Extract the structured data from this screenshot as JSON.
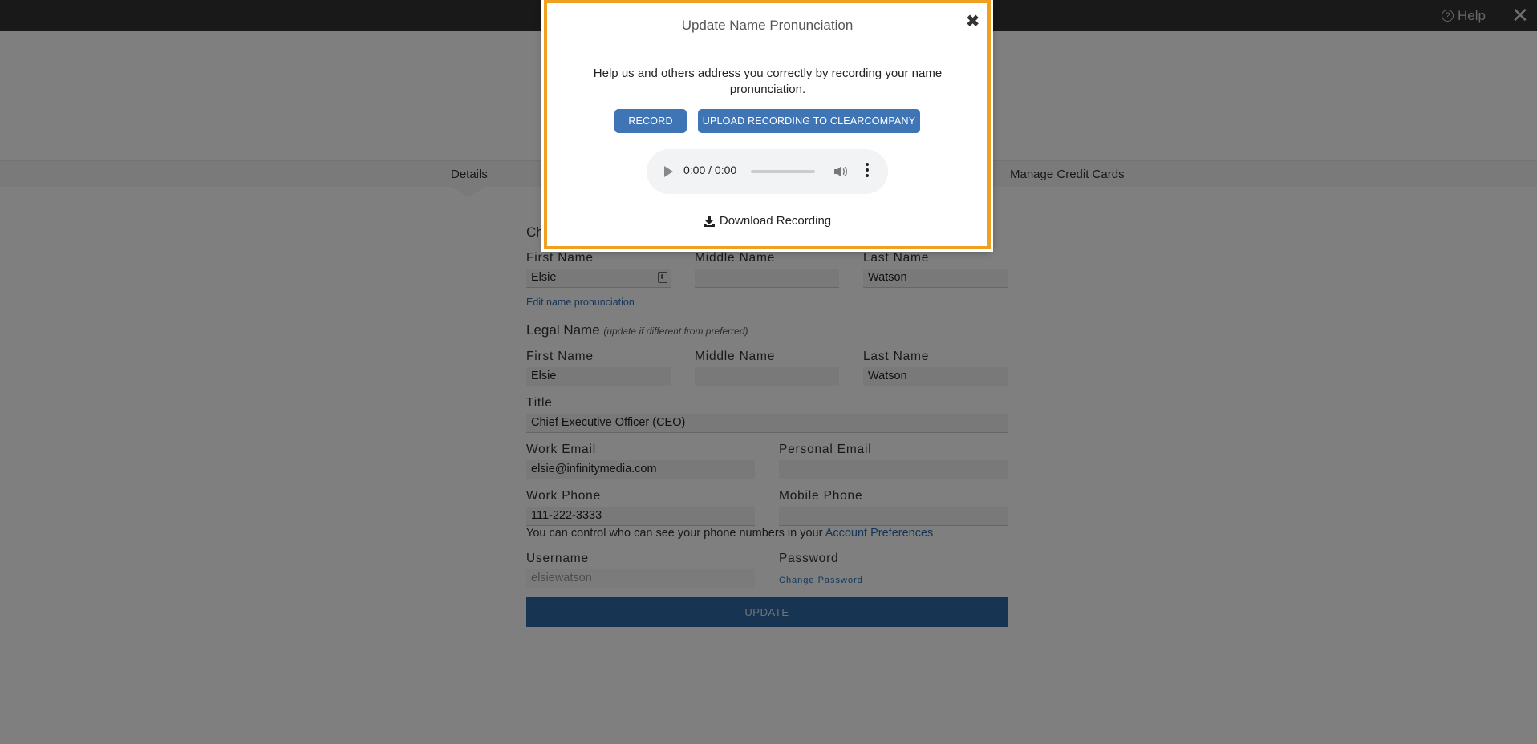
{
  "topbar": {
    "help_label": "Help",
    "close_glyph": "✕"
  },
  "tabs": {
    "details": "Details",
    "manage_cards": "Manage Credit Cards"
  },
  "preferred": {
    "heading_partial": "Ch",
    "first_name_label": "First Name",
    "first_name_value": "Elsie",
    "middle_name_label": "Middle Name",
    "middle_name_value": "",
    "last_name_label": "Last Name",
    "last_name_value": "Watson",
    "edit_pronunciation_link": "Edit name pronunciation"
  },
  "legal": {
    "heading": "Legal Name",
    "heading_note": "(update if different from preferred)",
    "first_name_label": "First Name",
    "first_name_value": "Elsie",
    "middle_name_label": "Middle Name",
    "middle_name_value": "",
    "last_name_label": "Last Name",
    "last_name_value": "Watson"
  },
  "title": {
    "label": "Title",
    "value": "Chief Executive Officer (CEO)"
  },
  "email": {
    "work_label": "Work Email",
    "work_value": "elsie@infinitymedia.com",
    "personal_label": "Personal Email",
    "personal_value": ""
  },
  "phone": {
    "work_label": "Work Phone",
    "work_value": "111-222-3333",
    "mobile_label": "Mobile Phone",
    "mobile_value": "",
    "note_text": "You can control who can see your phone numbers in your ",
    "note_link": "Account Preferences"
  },
  "account": {
    "username_label": "Username",
    "username_value": "elsiewatson",
    "password_label": "Password",
    "change_password_link": "Change Password"
  },
  "update_button": "UPDATE",
  "modal": {
    "title": "Update Name Pronunciation",
    "close_glyph": "✖",
    "text": "Help us and others address you correctly by recording your name pronunciation.",
    "record_button": "RECORD",
    "upload_button": "UPLOAD RECORDING TO CLEARCOMPANY",
    "audio_time": "0:00 / 0:00",
    "download_label": "Download Recording"
  },
  "colors": {
    "accent_button": "#3f74b5",
    "modal_border": "#f0a020",
    "link": "#2a6db3"
  }
}
